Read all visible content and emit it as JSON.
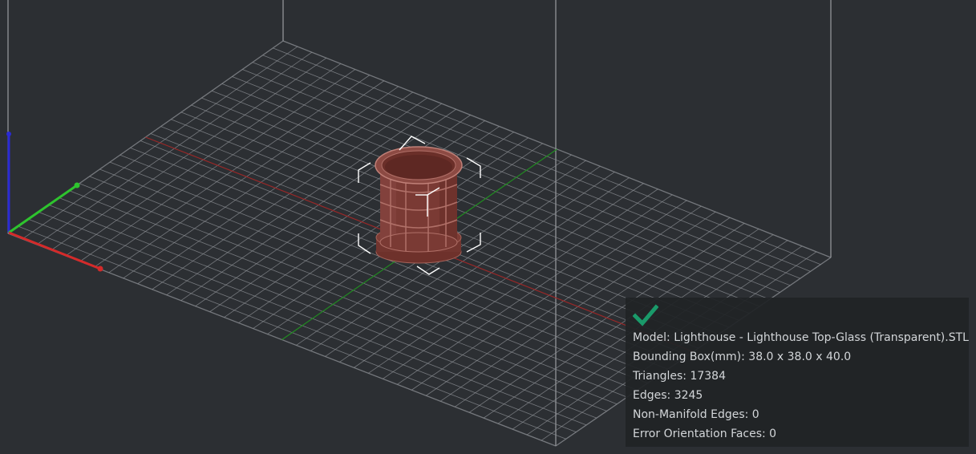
{
  "viewport": {
    "background_color": "#2c2f33",
    "grid_color": "#8e9196",
    "frame_color": "#9a9da1",
    "axis_colors": {
      "x": "#d42a2a",
      "y": "#2ec42e",
      "z": "#2a2ad4"
    },
    "model_color": "#7a3a34",
    "selection_box_color": "#ffffff"
  },
  "model_info": {
    "status_icon": "check-icon",
    "status_color": "#1a9a6a",
    "lines": [
      "Model: Lighthouse - Lighthouse Top-Glass (Transparent).STL",
      "Bounding Box(mm): 38.0 x 38.0 x 40.0",
      "Triangles: 17384",
      "Edges: 3245",
      "Non-Manifold Edges: 0",
      "Error Orientation Faces: 0"
    ]
  }
}
